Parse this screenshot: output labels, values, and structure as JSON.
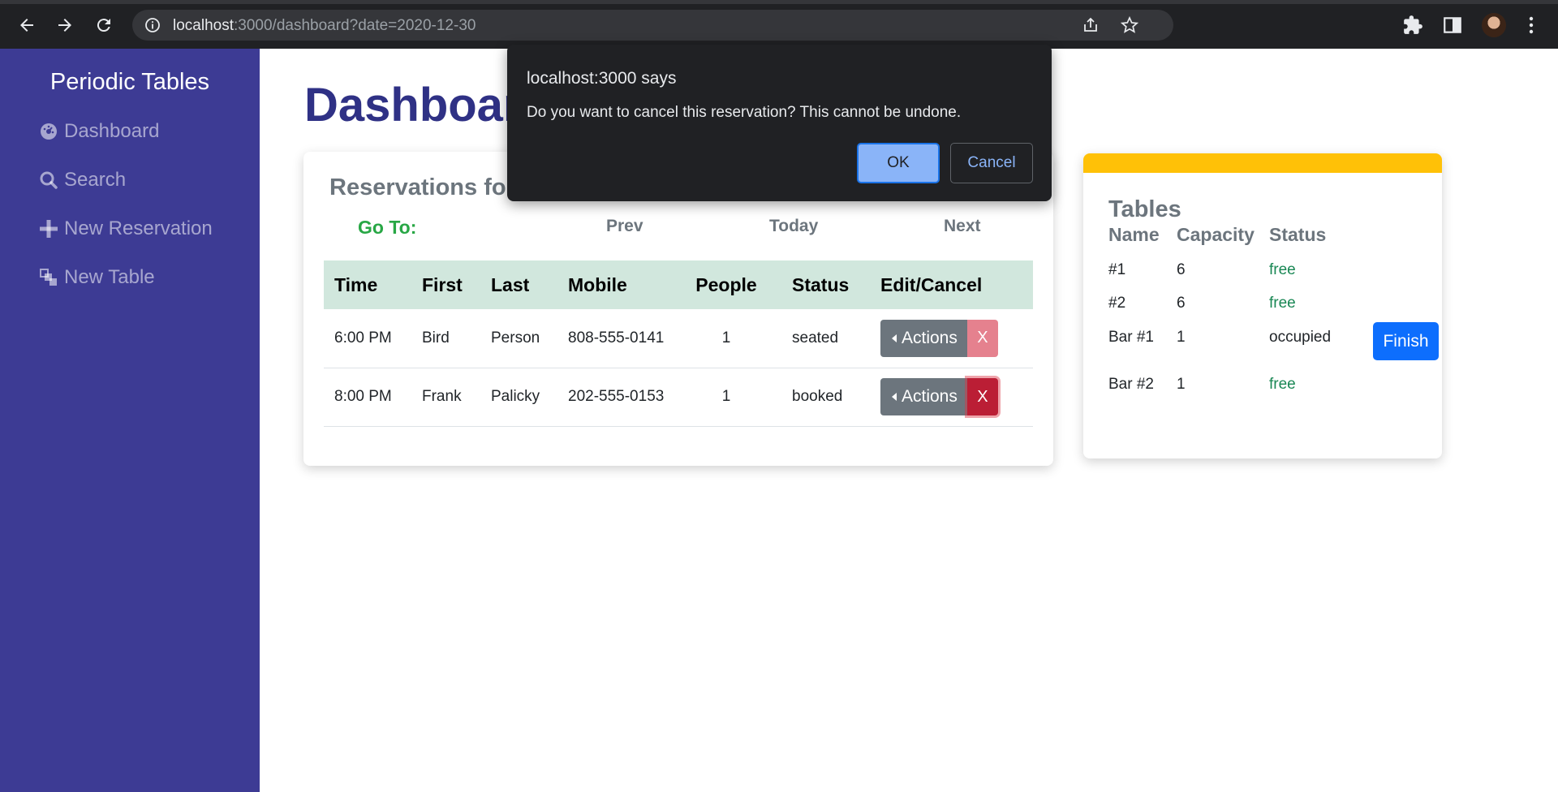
{
  "browser": {
    "url_host": "localhost",
    "url_rest": ":3000/dashboard?date=2020-12-30"
  },
  "sidebar": {
    "brand": "Periodic Tables",
    "items": [
      {
        "label": "Dashboard",
        "icon": "dashboard-icon"
      },
      {
        "label": "Search",
        "icon": "search-icon"
      },
      {
        "label": "New Reservation",
        "icon": "plus-icon"
      },
      {
        "label": "New Table",
        "icon": "tables-icon"
      }
    ]
  },
  "main": {
    "title": "Dashboard",
    "reservations": {
      "heading": "Reservations for",
      "goto_label": "Go To:",
      "prev": "Prev",
      "today": "Today",
      "next": "Next",
      "columns": [
        "Time",
        "First",
        "Last",
        "Mobile",
        "People",
        "Status",
        "Edit/Cancel"
      ],
      "rows": [
        {
          "time": "6:00 PM",
          "first": "Bird",
          "last": "Person",
          "mobile": "808-555-0141",
          "people": "1",
          "status": "seated",
          "actions": "Actions",
          "cancel": "X"
        },
        {
          "time": "8:00 PM",
          "first": "Frank",
          "last": "Palicky",
          "mobile": "202-555-0153",
          "people": "1",
          "status": "booked",
          "actions": "Actions",
          "cancel": "X"
        }
      ]
    },
    "tables": {
      "heading": "Tables",
      "columns": [
        "Name",
        "Capacity",
        "Status"
      ],
      "rows": [
        {
          "name": "#1",
          "capacity": "6",
          "status": "free"
        },
        {
          "name": "#2",
          "capacity": "6",
          "status": "free"
        },
        {
          "name": "Bar #1",
          "capacity": "1",
          "status": "occupied",
          "finish": "Finish"
        },
        {
          "name": "Bar #2",
          "capacity": "1",
          "status": "free"
        }
      ]
    }
  },
  "dialog": {
    "title": "localhost:3000 says",
    "message": "Do you want to cancel this reservation? This cannot be undone.",
    "ok": "OK",
    "cancel": "Cancel"
  },
  "colors": {
    "sidebar": "#3d3b94",
    "title": "#2f3185",
    "table_header": "#d1e7dd",
    "tables_topbar": "#ffc107",
    "free_status": "#198754",
    "finish_button": "#0d6efd",
    "dialog_bg": "#202124"
  }
}
